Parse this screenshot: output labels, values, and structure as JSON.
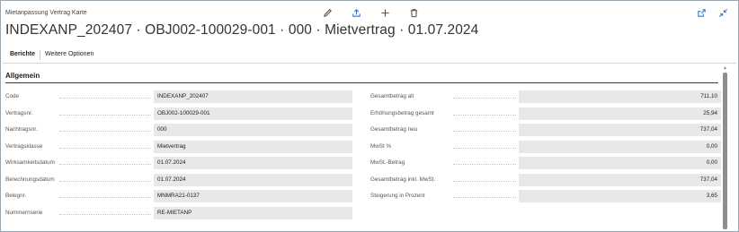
{
  "window": {
    "caption": "Mietanpassung Vertrag Karte",
    "title": "INDEXANP_202407 · OBJ002-100029-001 · 000 · Mietvertrag · 01.07.2024"
  },
  "toolbar": {
    "icons": [
      "edit-icon",
      "share-icon",
      "add-icon",
      "delete-icon"
    ],
    "right_icons": [
      "open-new-window-icon",
      "collapse-icon"
    ]
  },
  "actions": {
    "reports": "Berichte",
    "more_options": "Weitere Optionen"
  },
  "section": {
    "title": "Allgemein"
  },
  "left_fields": [
    {
      "label": "Code",
      "value": "INDEXANP_202407"
    },
    {
      "label": "Vertragsnr.",
      "value": "OBJ002-100029-001"
    },
    {
      "label": "Nachtragsnr.",
      "value": "000"
    },
    {
      "label": "Vertragsklasse",
      "value": "Mietvertrag"
    },
    {
      "label": "Wirksamkeitsdatum",
      "value": "01.07.2024"
    },
    {
      "label": "Berechnungsdatum",
      "value": "01.07.2024"
    },
    {
      "label": "Belegnr.",
      "value": "MNMRA21-0137"
    },
    {
      "label": "Nummernserie",
      "value": "RE-MIETANP"
    }
  ],
  "right_fields": [
    {
      "label": "Gesamtbetrag alt",
      "value": "711,10"
    },
    {
      "label": "Erhöhungsbetrag gesamt",
      "value": "25,94"
    },
    {
      "label": "Gesamtbetrag neu",
      "value": "737,04"
    },
    {
      "label": "MwSt %",
      "value": "0,00"
    },
    {
      "label": "MwSt.-Betrag",
      "value": "0,00"
    },
    {
      "label": "Gesamtbetrag inkl. MwSt.",
      "value": "737,04"
    },
    {
      "label": "Steigerung in Prozent",
      "value": "3,65"
    }
  ],
  "colors": {
    "accent": "#3a78c2",
    "field_bg": "#e8e8e8",
    "border": "#9aa6b0"
  }
}
